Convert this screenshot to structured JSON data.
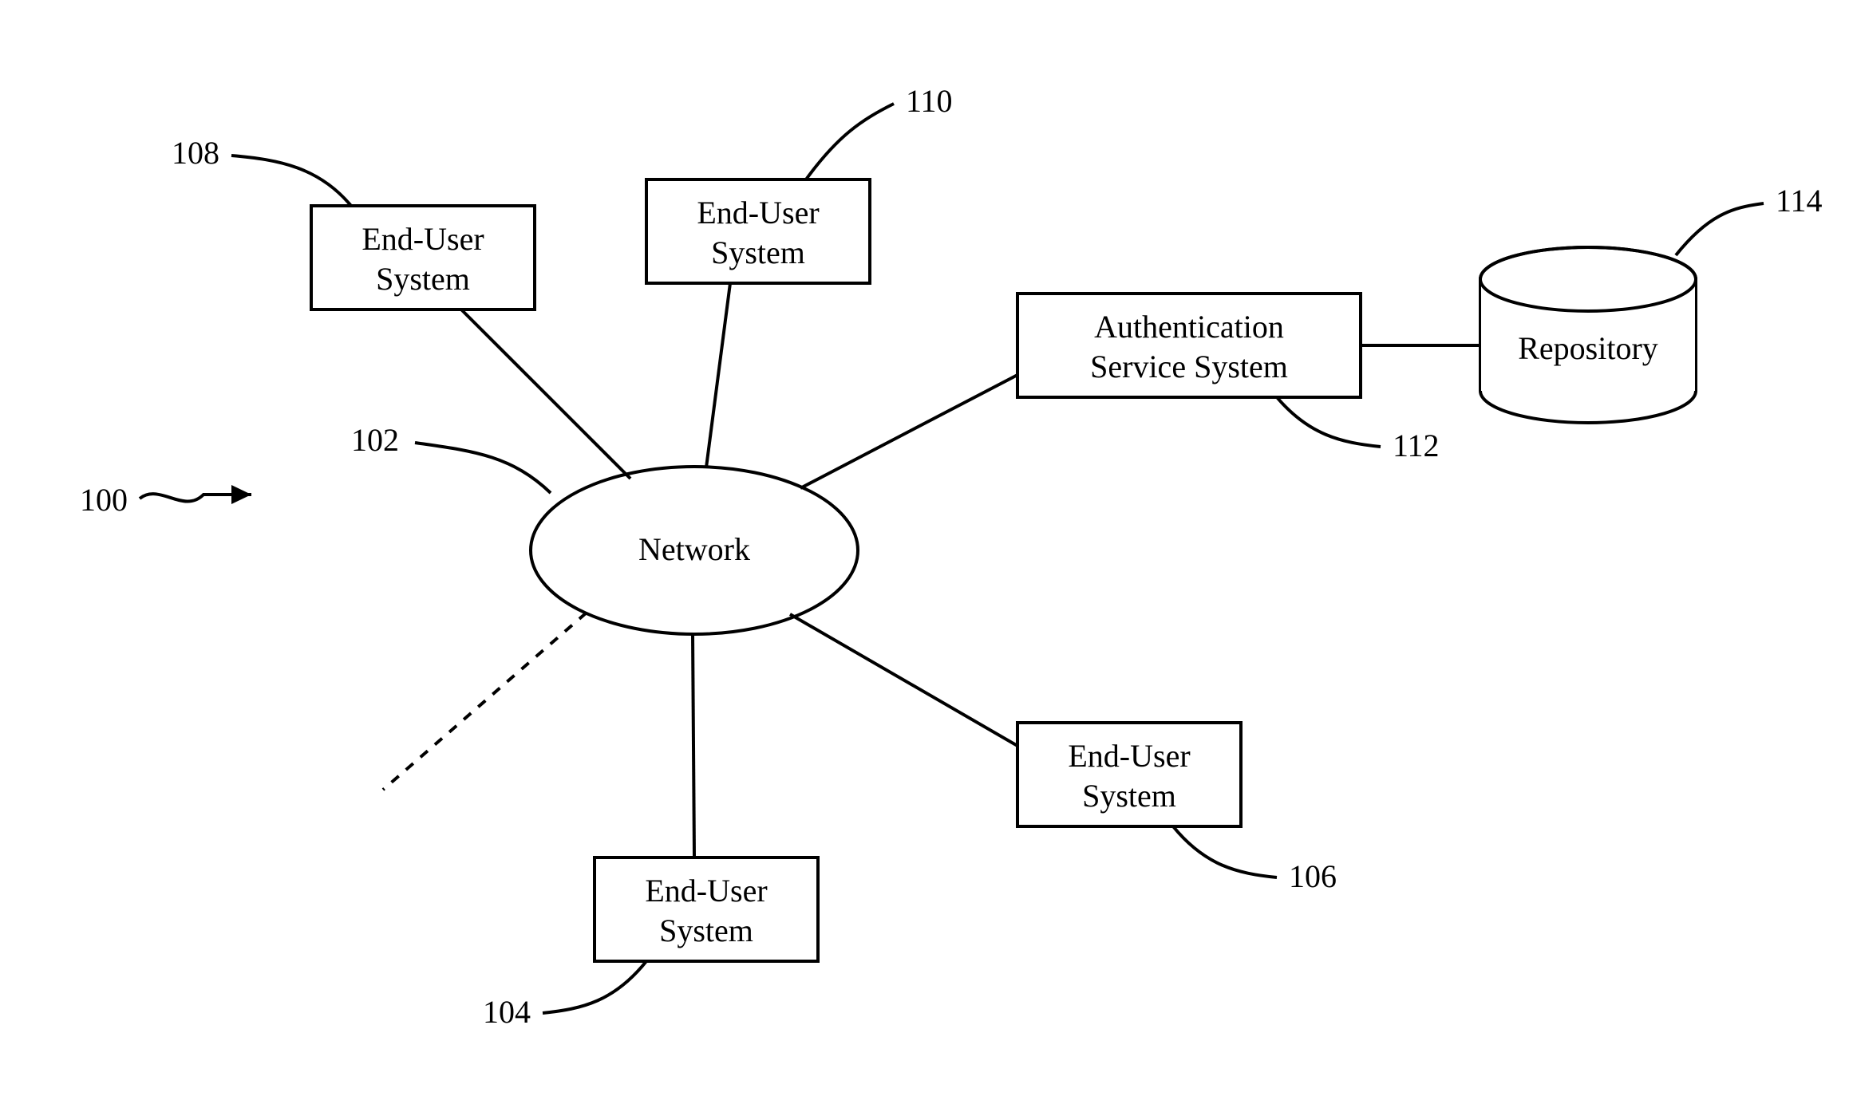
{
  "diagram": {
    "reference_label_100": "100",
    "network": {
      "label": "Network",
      "ref": "102"
    },
    "end_user_systems": {
      "box_108": {
        "line1": "End-User",
        "line2": "System",
        "ref": "108"
      },
      "box_110": {
        "line1": "End-User",
        "line2": "System",
        "ref": "110"
      },
      "box_104": {
        "line1": "End-User",
        "line2": "System",
        "ref": "104"
      },
      "box_106": {
        "line1": "End-User",
        "line2": "System",
        "ref": "106"
      }
    },
    "auth_system": {
      "line1": "Authentication",
      "line2": "Service System",
      "ref": "112"
    },
    "repository": {
      "label": "Repository",
      "ref": "114"
    }
  }
}
